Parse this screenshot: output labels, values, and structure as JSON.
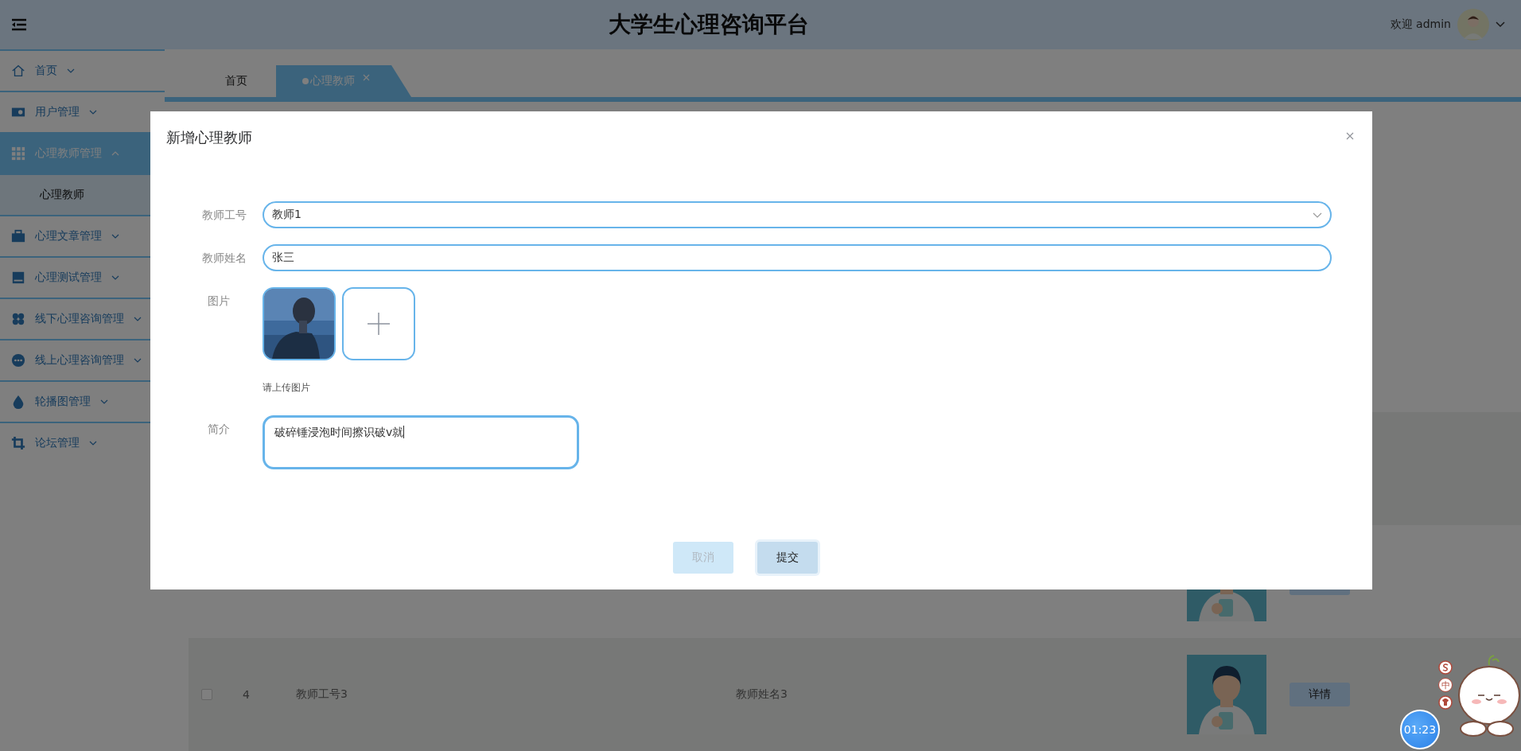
{
  "header": {
    "title": "大学生心理咨询平台",
    "welcome": "欢迎 admin"
  },
  "sidebar": {
    "items": [
      {
        "label": "首页",
        "expanded": false,
        "selected": false
      },
      {
        "label": "用户管理",
        "expanded": false,
        "selected": false
      },
      {
        "label": "心理教师管理",
        "expanded": true,
        "selected": true,
        "children": [
          {
            "label": "心理教师",
            "selected": true
          }
        ]
      },
      {
        "label": "心理文章管理",
        "expanded": false,
        "selected": false
      },
      {
        "label": "心理测试管理",
        "expanded": false,
        "selected": false
      },
      {
        "label": "线下心理咨询管理",
        "expanded": false,
        "selected": false
      },
      {
        "label": "线上心理咨询管理",
        "expanded": false,
        "selected": false
      },
      {
        "label": "轮播图管理",
        "expanded": false,
        "selected": false
      },
      {
        "label": "论坛管理",
        "expanded": false,
        "selected": false
      }
    ]
  },
  "tabs": [
    {
      "label": "首页",
      "selected": false,
      "closable": false
    },
    {
      "label": "心理教师",
      "selected": true,
      "closable": true
    }
  ],
  "table": {
    "rows": [
      {
        "kind": "partial"
      },
      {
        "kind": "full",
        "checked": false,
        "index": "4",
        "teacher_id": "教师工号3",
        "teacher_name": "教师姓名3",
        "action": "详情"
      }
    ]
  },
  "dialog": {
    "title": "新增心理教师",
    "fields": [
      {
        "kind": "select",
        "label": "教师工号",
        "value": "教师1"
      },
      {
        "kind": "input",
        "label": "教师姓名",
        "value": "张三"
      },
      {
        "kind": "upload",
        "label": "图片",
        "hint": "请上传图片"
      },
      {
        "kind": "textarea",
        "label": "简介",
        "value": "破碎锤浸泡时间擦识破v就"
      }
    ],
    "buttons": [
      {
        "label": "取消",
        "kind": "cancel"
      },
      {
        "label": "提交",
        "kind": "submit"
      }
    ]
  },
  "ime": {
    "label": "中"
  },
  "timer": {
    "text": "01:23"
  }
}
